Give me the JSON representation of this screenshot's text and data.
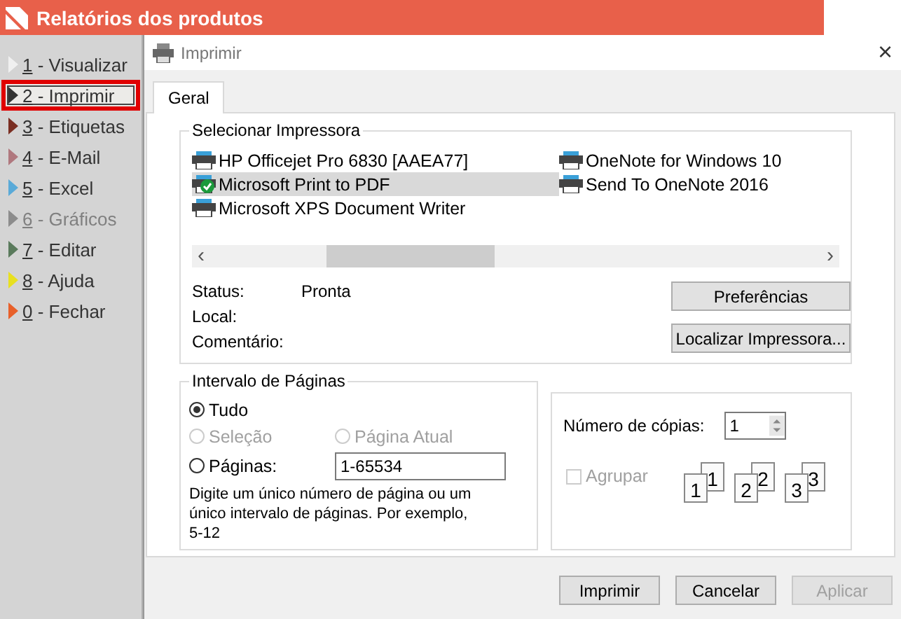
{
  "app_title": "Relatórios dos produtos",
  "menu": [
    {
      "text": "1 - Visualizar",
      "color": "#f0f0f0",
      "selected": false,
      "disabled": false
    },
    {
      "text": "2 - Imprimir",
      "color": "#333333",
      "selected": true,
      "disabled": false
    },
    {
      "text": "3 - Etiquetas",
      "color": "#7a2e22",
      "selected": false,
      "disabled": false
    },
    {
      "text": "4 - E-Mail",
      "color": "#b0787e",
      "selected": false,
      "disabled": false
    },
    {
      "text": "5 - Excel",
      "color": "#5aaad8",
      "selected": false,
      "disabled": false
    },
    {
      "text": "6 - Gráficos",
      "color": "#8c8c8c",
      "selected": false,
      "disabled": true
    },
    {
      "text": "7 - Editar",
      "color": "#5a7a5c",
      "selected": false,
      "disabled": false
    },
    {
      "text": "8 - Ajuda",
      "color": "#e8e020",
      "selected": false,
      "disabled": false
    },
    {
      "text": "0 - Fechar",
      "color": "#e8602a",
      "selected": false,
      "disabled": false
    }
  ],
  "dialog": {
    "title": "Imprimir",
    "close": "×",
    "tabs": [
      {
        "label": "Geral",
        "selected": true
      }
    ],
    "printer_group": {
      "title": "Selecionar Impressora",
      "columns": [
        [
          {
            "name": "HP Officejet Pro 6830 [AAEA77]",
            "selected": false
          },
          {
            "name": "Microsoft Print to PDF",
            "selected": true
          },
          {
            "name": "Microsoft XPS Document Writer",
            "selected": false
          }
        ],
        [
          {
            "name": "OneNote for Windows 10",
            "selected": false
          },
          {
            "name": "Send To OneNote 2016",
            "selected": false
          }
        ]
      ],
      "scroll_left": "‹",
      "scroll_right": "›",
      "info": [
        {
          "label": "Status:",
          "value": "Pronta"
        },
        {
          "label": "Local:"
        },
        {
          "label": "Comentário:"
        }
      ],
      "buttons": [
        "Preferências",
        "Localizar Impressora..."
      ]
    },
    "range_group": {
      "title": "Intervalo de Páginas",
      "options": [
        {
          "label": "Tudo",
          "selected": true,
          "disabled": false
        },
        {
          "label": "Seleção",
          "selected": false,
          "disabled": true
        },
        {
          "label": "Página Atual",
          "selected": false,
          "disabled": true
        },
        {
          "label": "Páginas:",
          "selected": false,
          "disabled": false
        }
      ],
      "pages_value": "1-65534",
      "hint": "Digite um único número de página ou um único intervalo de páginas. Por exemplo, 5-12"
    },
    "copies_group": {
      "label": "Número de cópias:",
      "value": "1",
      "collate": {
        "label": "Agrupar",
        "checked": false,
        "disabled": true
      },
      "pages": [
        "1",
        "1",
        "2",
        "2",
        "3",
        "3"
      ]
    },
    "buttons": [
      {
        "label": "Imprimir",
        "disabled": false
      },
      {
        "label": "Cancelar",
        "disabled": false
      },
      {
        "label": "Aplicar",
        "disabled": true
      }
    ]
  }
}
